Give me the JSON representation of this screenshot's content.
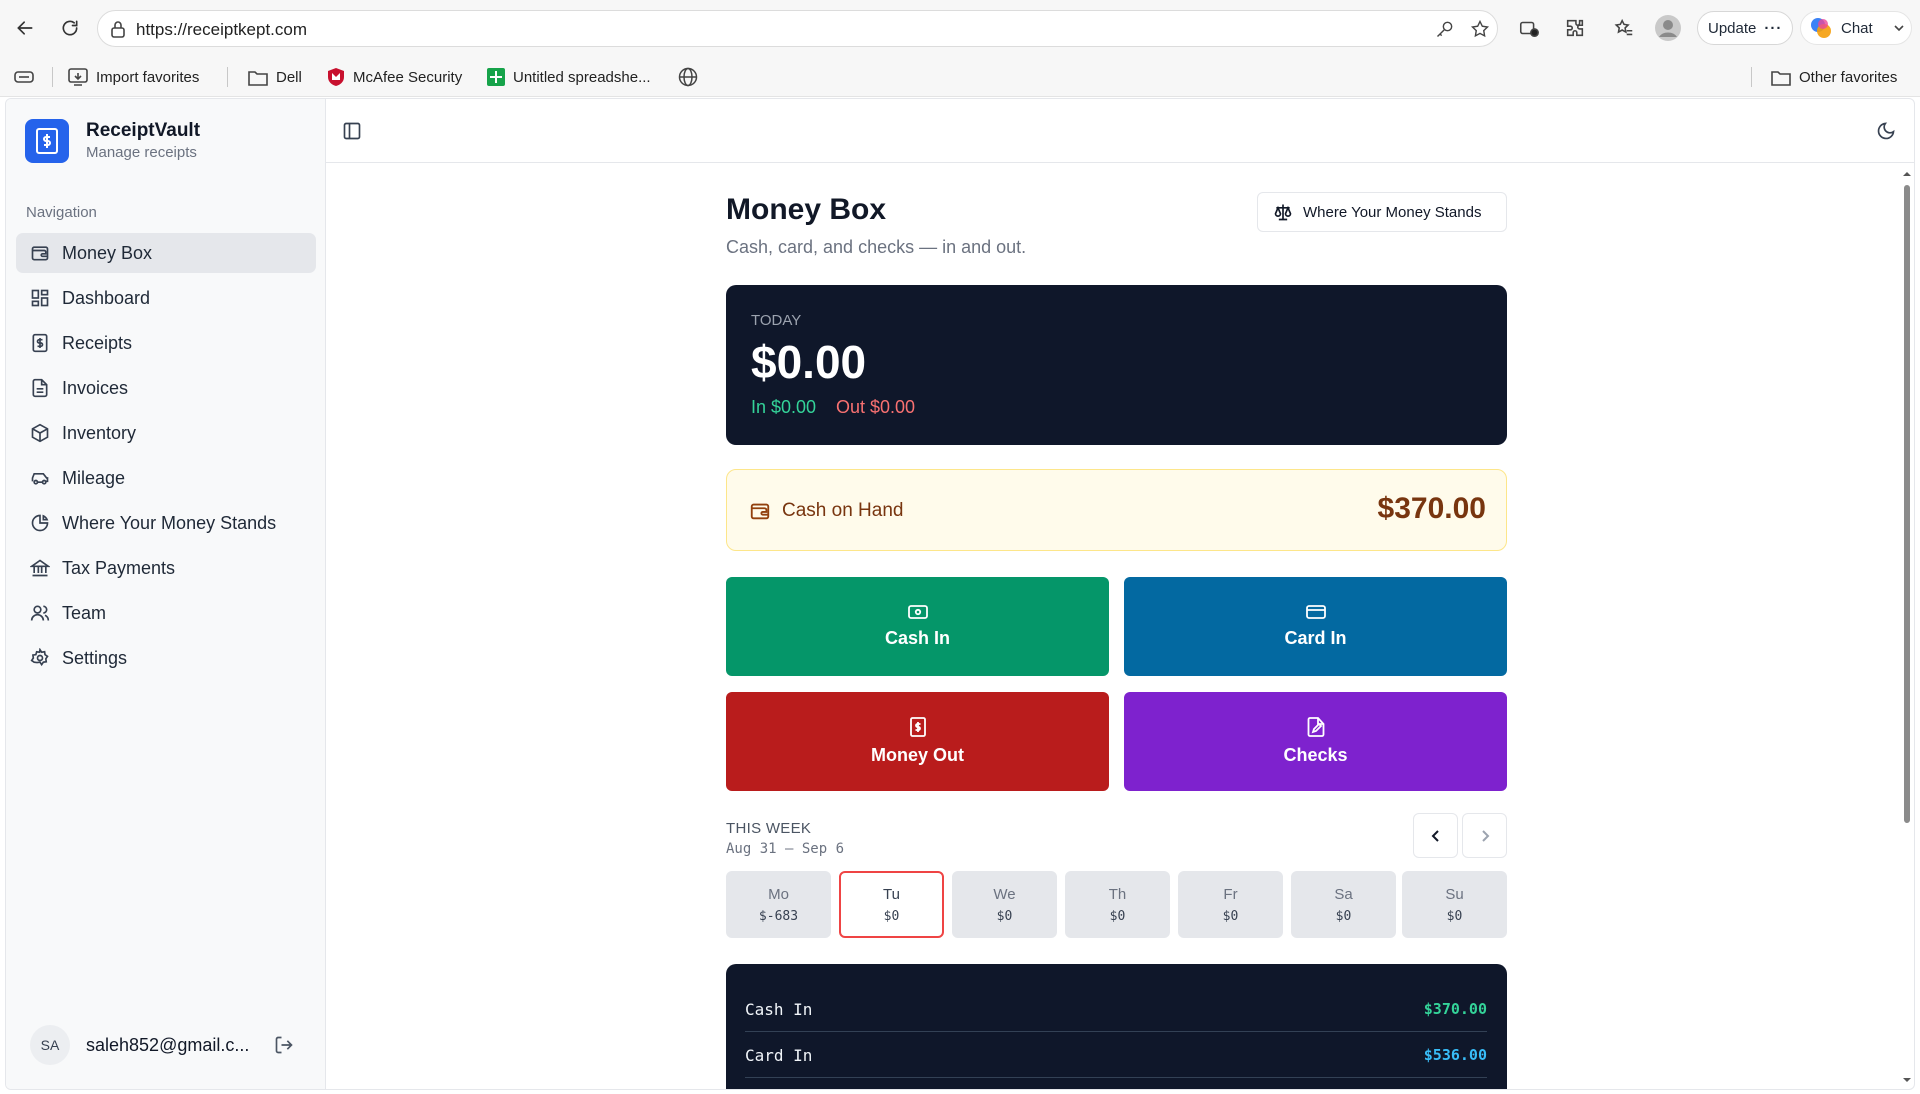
{
  "browser": {
    "url": "https://receiptkept.com",
    "update_label": "Update",
    "chat_label": "Chat",
    "bookmarks": [
      {
        "label": "Import favorites"
      },
      {
        "label": "Dell"
      },
      {
        "label": "McAfee Security"
      },
      {
        "label": "Untitled spreadshe..."
      }
    ],
    "other_favorites": "Other favorites"
  },
  "brand": {
    "name": "ReceiptVault",
    "subtitle": "Manage receipts",
    "color": "#2563eb"
  },
  "nav": {
    "heading": "Navigation",
    "items": [
      {
        "label": "Money Box",
        "icon": "wallet-icon",
        "active": true
      },
      {
        "label": "Dashboard",
        "icon": "grid-icon"
      },
      {
        "label": "Receipts",
        "icon": "receipt-icon"
      },
      {
        "label": "Invoices",
        "icon": "file-text-icon"
      },
      {
        "label": "Inventory",
        "icon": "package-icon"
      },
      {
        "label": "Mileage",
        "icon": "car-icon"
      },
      {
        "label": "Where Your Money Stands",
        "icon": "pie-chart-icon"
      },
      {
        "label": "Tax Payments",
        "icon": "landmark-icon"
      },
      {
        "label": "Team",
        "icon": "users-icon"
      },
      {
        "label": "Settings",
        "icon": "gear-icon"
      }
    ]
  },
  "user": {
    "initials": "SA",
    "email": "saleh852@gmail.c..."
  },
  "page": {
    "title": "Money Box",
    "subtitle": "Cash, card, and checks — in and out.",
    "stands_button": "Where Your Money Stands"
  },
  "today": {
    "label": "TODAY",
    "amount": "$0.00",
    "in": "In $0.00",
    "out": "Out $0.00"
  },
  "cash_on_hand": {
    "label": "Cash on Hand",
    "amount": "$370.00"
  },
  "actions": {
    "cash_in": "Cash In",
    "card_in": "Card In",
    "money_out": "Money Out",
    "checks": "Checks"
  },
  "week": {
    "label": "THIS WEEK",
    "range": "Aug 31 – Sep 6",
    "days": [
      {
        "name": "Mo",
        "value": "$-683"
      },
      {
        "name": "Tu",
        "value": "$0",
        "selected": true
      },
      {
        "name": "We",
        "value": "$0"
      },
      {
        "name": "Th",
        "value": "$0"
      },
      {
        "name": "Fr",
        "value": "$0"
      },
      {
        "name": "Sa",
        "value": "$0"
      },
      {
        "name": "Su",
        "value": "$0"
      }
    ]
  },
  "summary": [
    {
      "label": "Cash In",
      "value": "$370.00",
      "color": "#34d399"
    },
    {
      "label": "Card In",
      "value": "$536.00",
      "color": "#38bdf8"
    }
  ]
}
